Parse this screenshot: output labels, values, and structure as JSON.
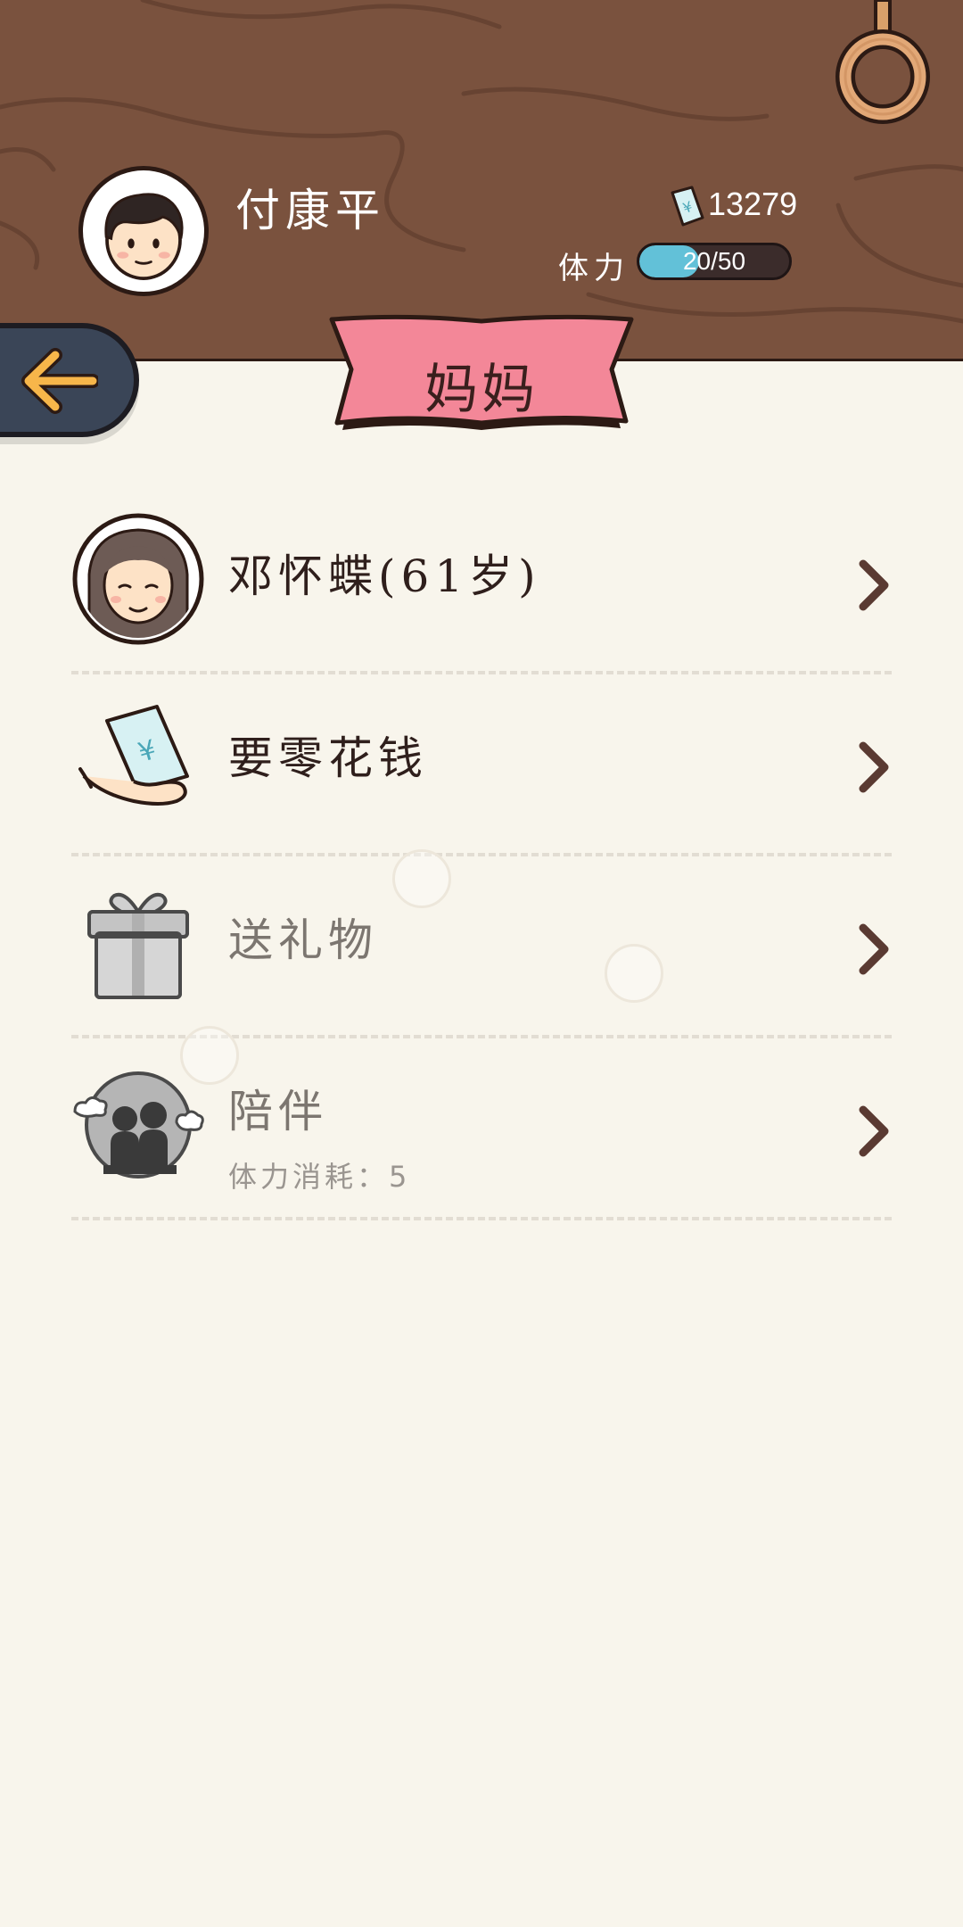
{
  "header": {
    "player_name": "付康平",
    "money": "13279",
    "stamina_label": "体力",
    "stamina_current": 20,
    "stamina_max": 50,
    "stamina_text": "20/50"
  },
  "title": "妈妈",
  "icons": {
    "back": "arrow-left-icon",
    "ring": "ring-handle-icon",
    "money": "money-bill-icon",
    "chevron": "chevron-right-icon"
  },
  "colors": {
    "wood": "#7a523e",
    "banner": "#f38798",
    "stamina_fill": "#62c1d8",
    "back_button": "#3a4557",
    "arrow": "#f7b64a",
    "background": "#f8f5ec"
  },
  "menu": [
    {
      "id": "mother-profile",
      "label": "邓怀蝶(61岁)",
      "icon": "elderly-woman-avatar-icon",
      "disabled": false
    },
    {
      "id": "pocket-money",
      "label": "要零花钱",
      "icon": "hand-money-icon",
      "disabled": false
    },
    {
      "id": "send-gift",
      "label": "送礼物",
      "icon": "gift-box-icon",
      "disabled": true
    },
    {
      "id": "accompany",
      "label": "陪伴",
      "sublabel": "体力消耗：5",
      "icon": "companions-icon",
      "disabled": true
    }
  ]
}
